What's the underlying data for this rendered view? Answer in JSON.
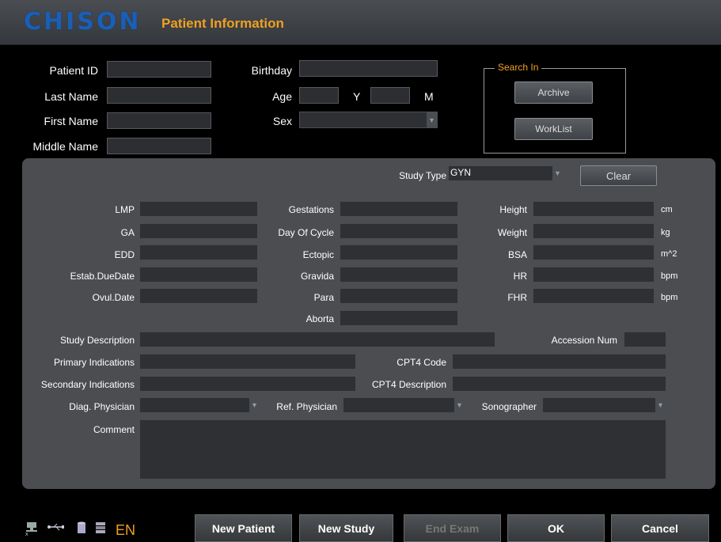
{
  "header": {
    "logo": "CHISON",
    "title": "Patient Information"
  },
  "patient": {
    "id_label": "Patient ID",
    "last_label": "Last Name",
    "first_label": "First Name",
    "middle_label": "Middle Name",
    "birthday_label": "Birthday",
    "age_label": "Age",
    "age_y": "Y",
    "age_m": "M",
    "sex_label": "Sex",
    "id": "",
    "last": "",
    "first": "",
    "middle": "",
    "birthday": "",
    "age_years": "",
    "age_months": "",
    "sex": ""
  },
  "search": {
    "label": "Search In",
    "archive": "Archive",
    "worklist": "WorkList"
  },
  "study": {
    "type_label": "Study Type",
    "type_value": "GYN",
    "clear": "Clear"
  },
  "gyn": {
    "col1": [
      "LMP",
      "GA",
      "EDD",
      "Estab.DueDate",
      "Ovul.Date"
    ],
    "col2": [
      "Gestations",
      "Day Of Cycle",
      "Ectopic",
      "Gravida",
      "Para",
      "Aborta"
    ],
    "col3": [
      "Height",
      "Weight",
      "BSA",
      "HR",
      "FHR"
    ],
    "units": [
      "cm",
      "kg",
      "m^2",
      "bpm",
      "bpm"
    ]
  },
  "info": {
    "study_desc": "Study Description",
    "accession": "Accession Num",
    "primary": "Primary Indications",
    "cpt4_code": "CPT4 Code",
    "secondary": "Secondary Indications",
    "cpt4_desc": "CPT4 Description",
    "diag": "Diag. Physician",
    "ref": "Ref. Physician",
    "sono": "Sonographer",
    "comment": "Comment"
  },
  "status": {
    "lang": "EN"
  },
  "buttons": {
    "new_patient": "New Patient",
    "new_study": "New Study",
    "end_exam": "End Exam",
    "ok": "OK",
    "cancel": "Cancel"
  },
  "colors": {
    "accent": "#f0a020",
    "logo": "#1a5fb4",
    "panel": "#4b4d50"
  }
}
